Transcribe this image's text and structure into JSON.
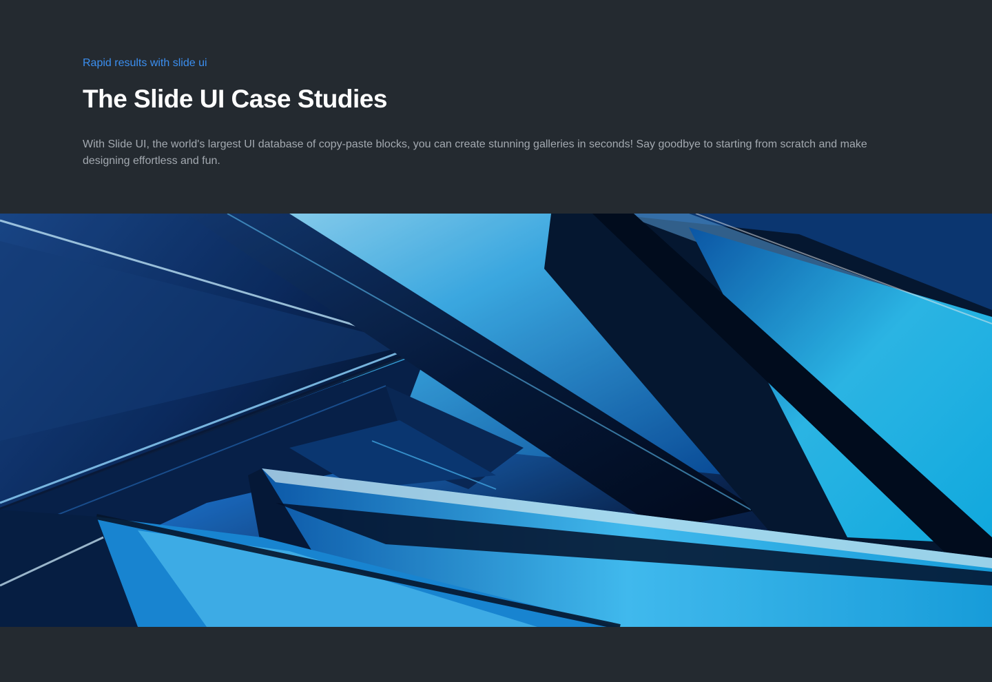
{
  "hero": {
    "eyebrow": "Rapid results with slide ui",
    "title": "The Slide UI Case Studies",
    "description": "With Slide UI, the world's largest UI database of copy-paste blocks, you can create stunning galleries in seconds! Say goodbye to starting from scratch and make designing effortless and fun."
  },
  "banner": {
    "image_icon": "abstract-blue-glass-image"
  },
  "colors": {
    "background": "#242a30",
    "accent": "#3b8ff0",
    "title": "#ffffff",
    "body_text": "#a3a9b0"
  }
}
